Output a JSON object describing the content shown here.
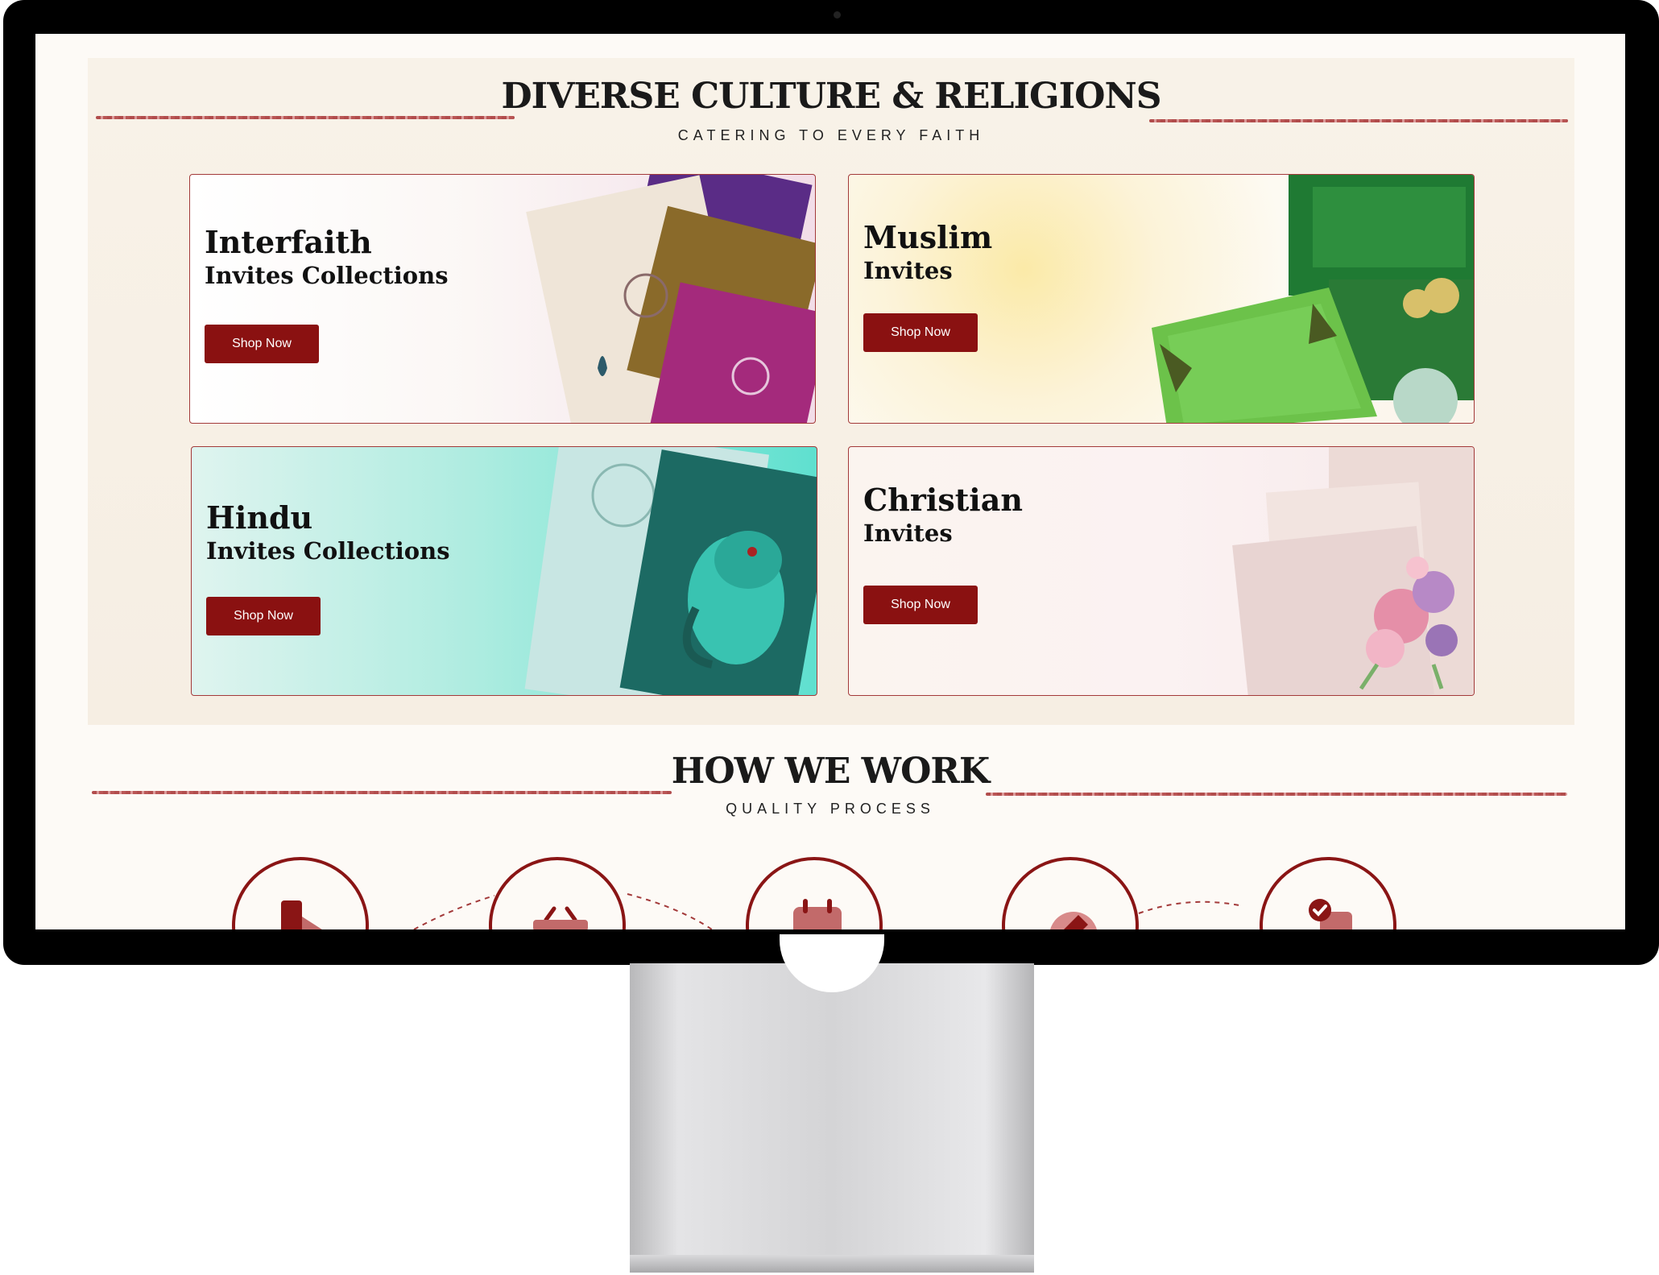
{
  "culture_section": {
    "title": "DIVERSE CULTURE & RELIGIONS",
    "subtitle": "CATERING TO EVERY FAITH"
  },
  "cards": [
    {
      "title": "Interfaith",
      "subtitle": "Invites Collections",
      "button": "Shop Now"
    },
    {
      "title": "Muslim",
      "subtitle": "Invites",
      "button": "Shop Now"
    },
    {
      "title": "Hindu",
      "subtitle": "Invites Collections",
      "button": "Shop Now"
    },
    {
      "title": "Christian",
      "subtitle": "Invites",
      "button": "Shop Now"
    }
  ],
  "how_section": {
    "title": "HOW WE WORK",
    "subtitle": "QUALITY PROCESS"
  },
  "process_icons": [
    "choose-design-icon",
    "basket-icon",
    "calendar-icon",
    "edit-tag-icon",
    "approved-document-icon"
  ],
  "colors": {
    "accent": "#8a1111",
    "card_border": "#a33a3a",
    "panel_background": "#f8f2e8",
    "page_background": "#fdfaf6"
  }
}
